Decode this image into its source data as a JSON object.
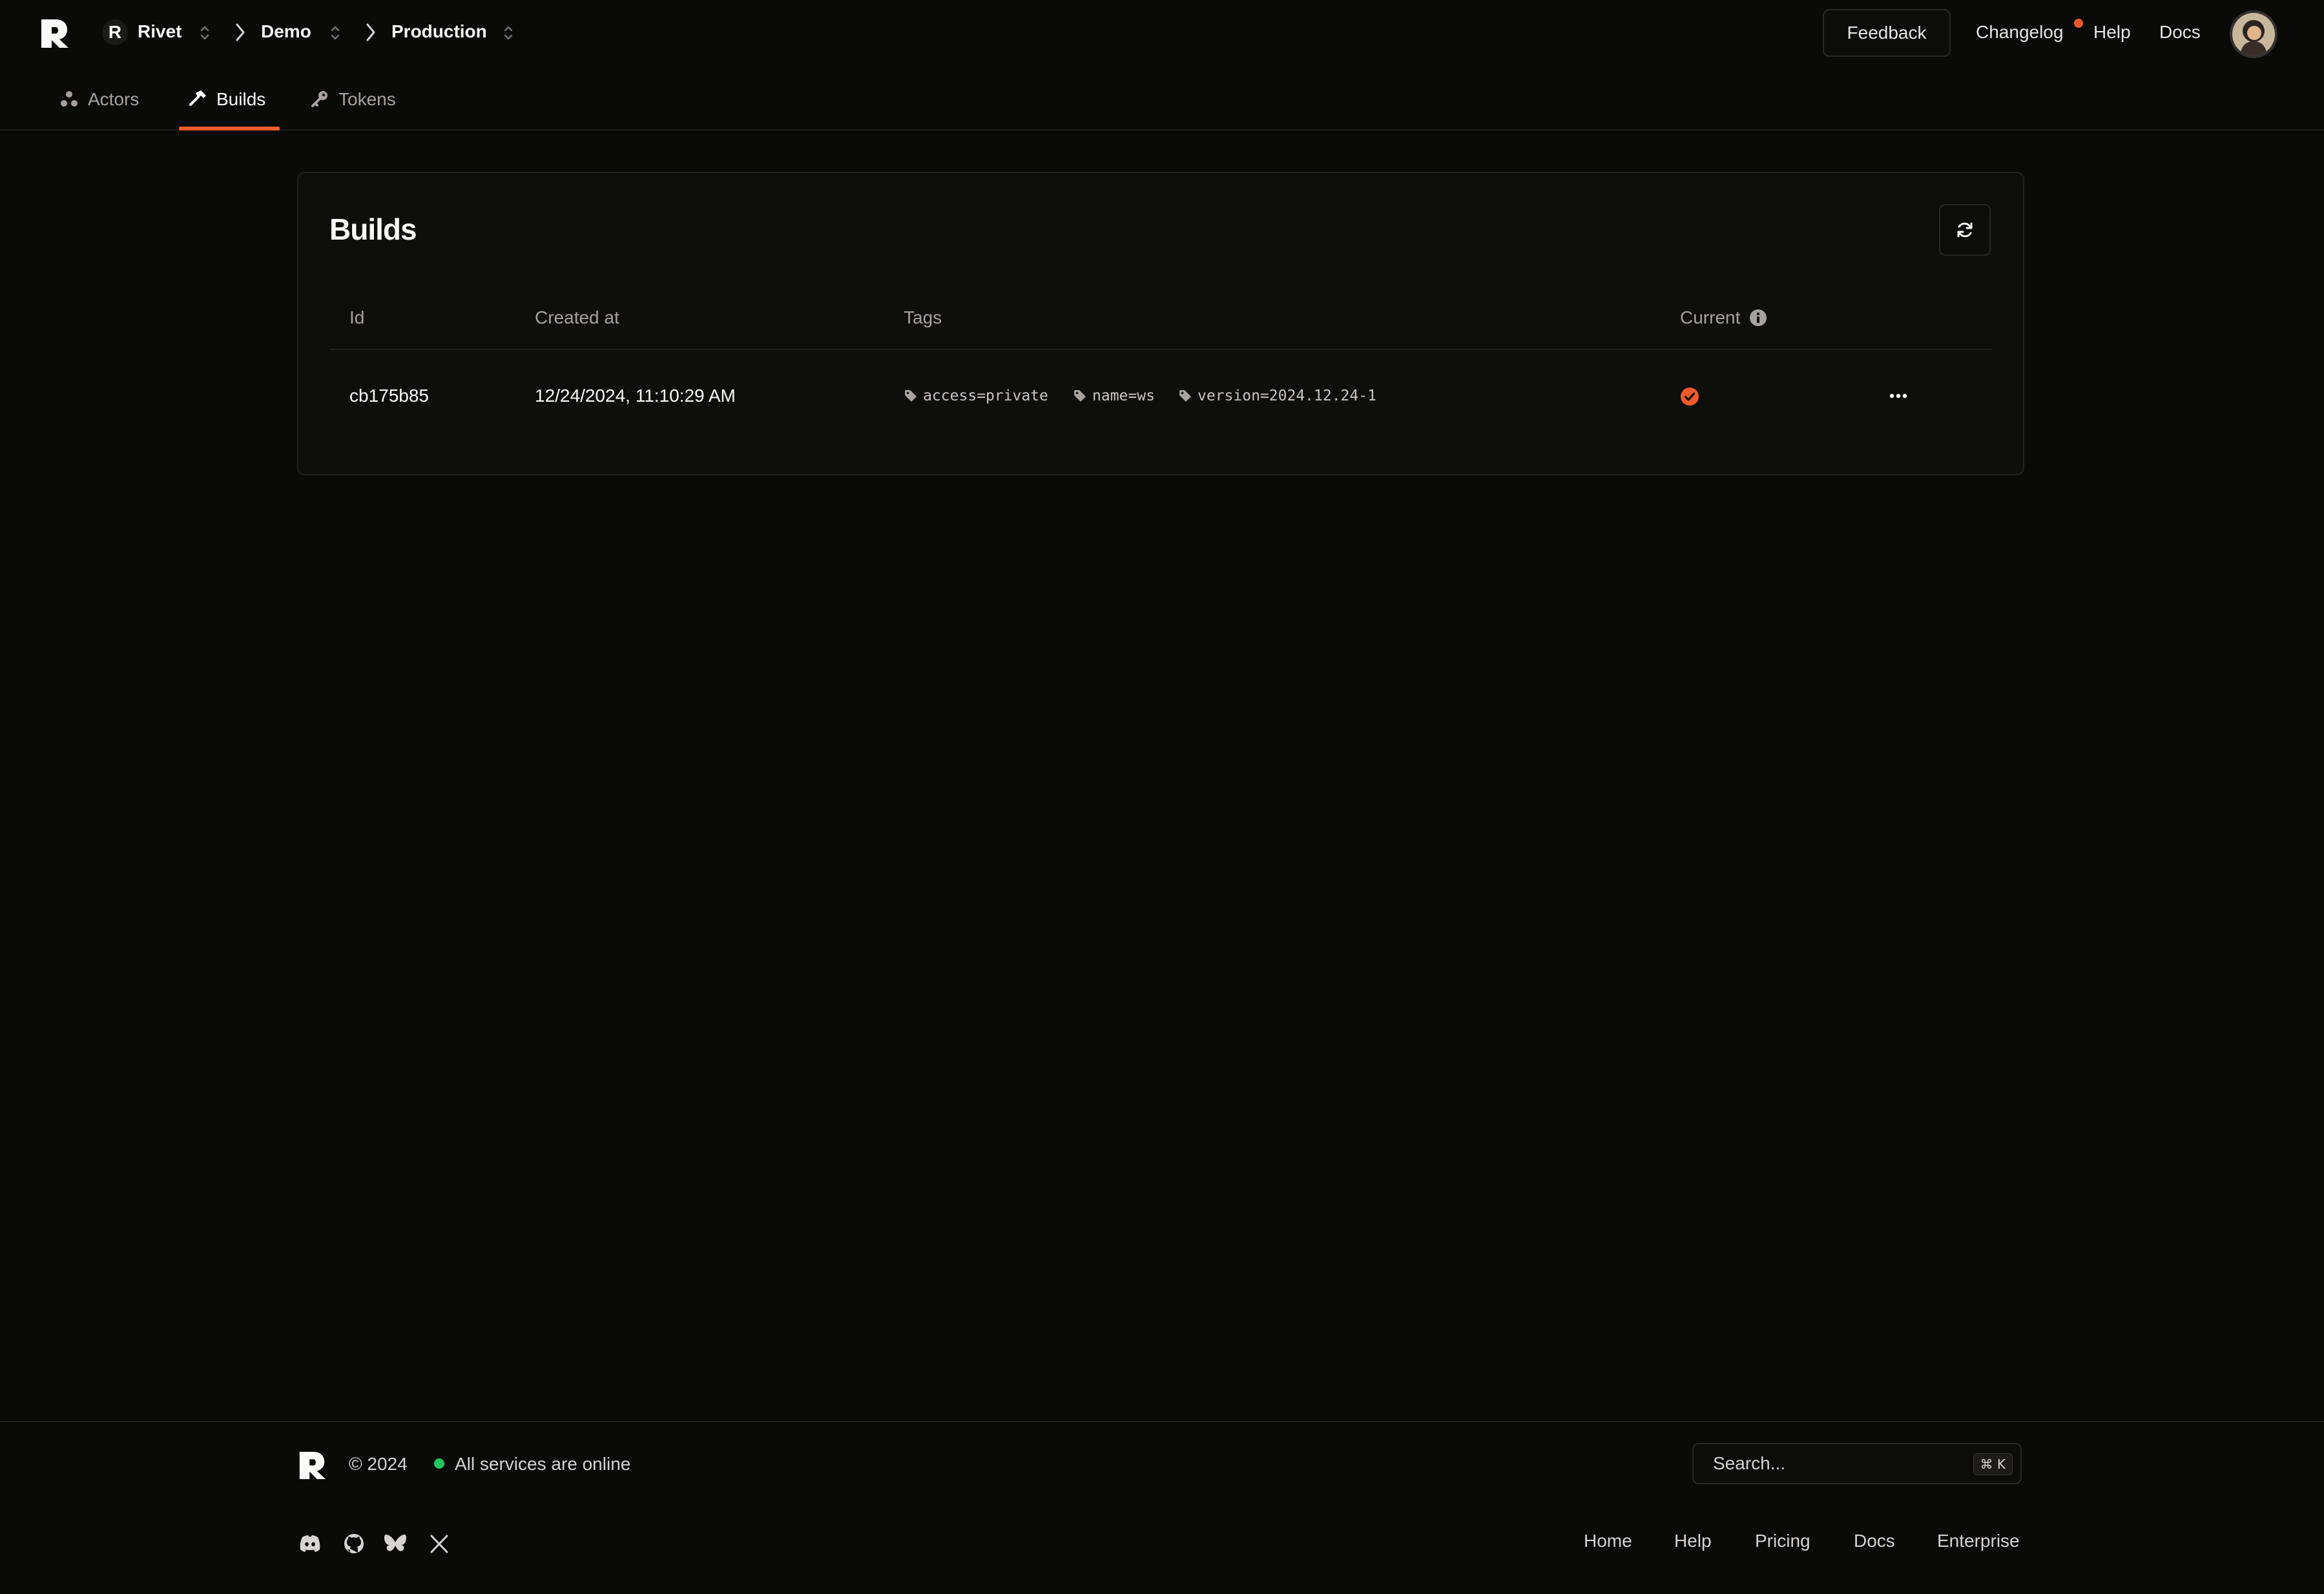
{
  "header": {
    "org_initial": "R",
    "org_name": "Rivet",
    "project": "Demo",
    "environment": "Production",
    "feedback_label": "Feedback",
    "changelog_label": "Changelog",
    "help_label": "Help",
    "docs_label": "Docs"
  },
  "tabs": [
    {
      "label": "Actors",
      "icon": "actors-icon"
    },
    {
      "label": "Builds",
      "icon": "hammer-icon",
      "active": true
    },
    {
      "label": "Tokens",
      "icon": "key-icon"
    }
  ],
  "builds": {
    "title": "Builds",
    "columns": [
      "Id",
      "Created at",
      "Tags",
      "Current"
    ],
    "rows": [
      {
        "id": "cb175b85",
        "created_at": "12/24/2024, 11:10:29 AM",
        "tags": [
          "access=private",
          "name=ws",
          "version=2024.12.24-1"
        ],
        "current": true
      }
    ]
  },
  "footer": {
    "copyright": "© 2024",
    "status": "All services are online",
    "search_placeholder": "Search...",
    "shortcut": "⌘ K",
    "links": [
      "Home",
      "Help",
      "Pricing",
      "Docs",
      "Enterprise"
    ]
  },
  "colors": {
    "accent": "#f05a2a",
    "background": "#0a0a09",
    "status_online": "#22c55e"
  }
}
